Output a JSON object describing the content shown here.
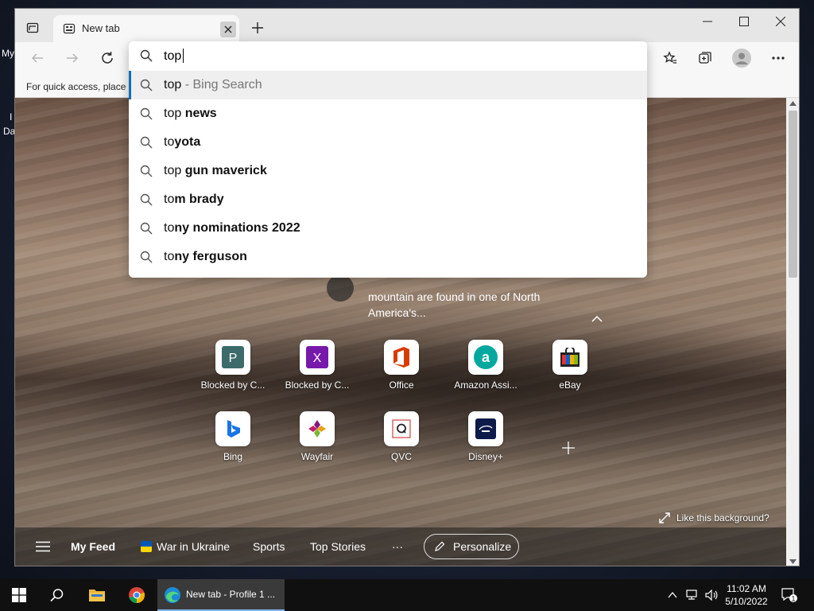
{
  "desktop": {
    "fragment_my": "My",
    "fragment_da": "Da",
    "fragment_i": "I"
  },
  "browser": {
    "tab": {
      "title": "New tab"
    },
    "favorites_bar": {
      "hint": "For quick access, place y"
    }
  },
  "omnibox": {
    "value": "top",
    "suggestions": [
      {
        "typed": "top",
        "completion": "",
        "suffix": " - Bing Search",
        "active": true
      },
      {
        "typed": "top ",
        "completion": "news",
        "suffix": ""
      },
      {
        "typed": "to",
        "completion": "yota",
        "suffix": ""
      },
      {
        "typed": "top ",
        "completion": "gun maverick",
        "suffix": ""
      },
      {
        "typed": "to",
        "completion": "m brady",
        "suffix": ""
      },
      {
        "typed": "to",
        "completion": "ny nominations 2022",
        "suffix": ""
      },
      {
        "typed": "to",
        "completion": "ny ferguson",
        "suffix": ""
      }
    ]
  },
  "ntp": {
    "background_description": "mountain are found in one of North America's...",
    "tiles": [
      {
        "label": "Blocked by C...",
        "icon": "P"
      },
      {
        "label": "Blocked by C...",
        "icon": "X"
      },
      {
        "label": "Office",
        "icon": "office-icon"
      },
      {
        "label": "Amazon Assi...",
        "icon": "a"
      },
      {
        "label": "eBay",
        "icon": "ebay-icon"
      },
      {
        "label": "Bing",
        "icon": "bing-icon"
      },
      {
        "label": "Wayfair",
        "icon": "wayfair-icon"
      },
      {
        "label": "QVC",
        "icon": "Q"
      },
      {
        "label": "Disney+",
        "icon": "disney-icon"
      }
    ],
    "like_background": "Like this background?",
    "feed": {
      "my_feed": "My Feed",
      "war_in_ukraine": "War in Ukraine",
      "sports": "Sports",
      "top_stories": "Top Stories",
      "more": "···",
      "personalize": "Personalize"
    }
  },
  "taskbar": {
    "edge_label": "New tab - Profile 1 ...",
    "time": "11:02 AM",
    "date": "5/10/2022",
    "notifications": "1"
  },
  "colors": {
    "accent": "#0f6cbd",
    "office_red": "#d83b01",
    "amazon_teal": "#00a8a0",
    "purple": "#7719aa",
    "pub_green": "#3d6a6a"
  }
}
